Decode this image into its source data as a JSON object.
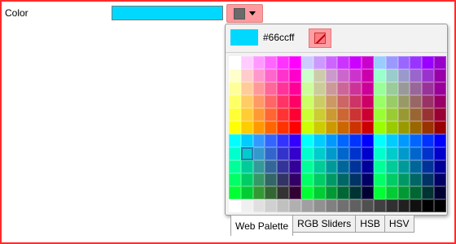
{
  "field": {
    "label": "Color",
    "value_color": "#00d8ff"
  },
  "dropdown": {
    "button_swatch": "#6a6a6a"
  },
  "popup": {
    "current_color_display": "#00d8ff",
    "hex_text": "#66ccff",
    "eyedropper_icon": "eyedropper-icon",
    "selected_cell": [
      7,
      1
    ],
    "palette_rows": [
      [
        "#ffffff",
        "#ffccff",
        "#ff99ff",
        "#ff66ff",
        "#ff33ff",
        "#ff00ff",
        "#ccccff",
        "#cc99ff",
        "#cc66ff",
        "#cc33ff",
        "#cc00ff",
        "#cc00cc",
        "#99ccff",
        "#9999ff",
        "#9966ff",
        "#9933ff",
        "#9900ff",
        "#9900cc"
      ],
      [
        "#ffffcc",
        "#ffcccc",
        "#ff99cc",
        "#ff66cc",
        "#ff33cc",
        "#ff00cc",
        "#ccffcc",
        "#ccccaa",
        "#cc99cc",
        "#cc66cc",
        "#cc33cc",
        "#cc00aa",
        "#99ffcc",
        "#99cccc",
        "#9999cc",
        "#9966cc",
        "#9933cc",
        "#9900aa"
      ],
      [
        "#ffff99",
        "#ffcc99",
        "#ff9999",
        "#ff6699",
        "#ff3399",
        "#ff0099",
        "#ccff99",
        "#cccc99",
        "#cc9999",
        "#cc6699",
        "#cc3399",
        "#cc0099",
        "#99ff99",
        "#99cc99",
        "#999999",
        "#996699",
        "#993399",
        "#990099"
      ],
      [
        "#ffff66",
        "#ffcc66",
        "#ff9966",
        "#ff6666",
        "#ff3366",
        "#ff0066",
        "#ccff66",
        "#cccc66",
        "#cc9966",
        "#cc6666",
        "#cc3366",
        "#cc0066",
        "#99ff66",
        "#99cc66",
        "#999966",
        "#996666",
        "#993366",
        "#990066"
      ],
      [
        "#ffff33",
        "#ffcc33",
        "#ff9933",
        "#ff6633",
        "#ff3333",
        "#ff0033",
        "#ccff33",
        "#cccc33",
        "#cc9933",
        "#cc6633",
        "#cc3333",
        "#cc0033",
        "#99ff33",
        "#99cc33",
        "#999933",
        "#996633",
        "#993333",
        "#990033"
      ],
      [
        "#ffff00",
        "#ffcc00",
        "#ff9900",
        "#ff6600",
        "#ff3300",
        "#ff0000",
        "#ccff00",
        "#cccc00",
        "#cc9900",
        "#cc6600",
        "#cc3300",
        "#cc0000",
        "#99ff00",
        "#99cc00",
        "#999900",
        "#996600",
        "#993300",
        "#990000"
      ],
      [
        "#00ffff",
        "#00ccff",
        "#3399ff",
        "#3366ff",
        "#3333ff",
        "#3300ff",
        "#00ffff",
        "#00ccff",
        "#0099ff",
        "#0066ff",
        "#0033ff",
        "#0000ff",
        "#00ffff",
        "#00ccff",
        "#0099ff",
        "#0066ff",
        "#0033ff",
        "#0000ff"
      ],
      [
        "#00ffcc",
        "#00cccc",
        "#3399cc",
        "#3366cc",
        "#3333cc",
        "#3300cc",
        "#00ffcc",
        "#00cccc",
        "#0099cc",
        "#0066cc",
        "#0033cc",
        "#0000cc",
        "#00ffcc",
        "#00cccc",
        "#0099cc",
        "#0066cc",
        "#0033cc",
        "#0000cc"
      ],
      [
        "#00ff99",
        "#00cc99",
        "#339999",
        "#336699",
        "#333399",
        "#330099",
        "#00ff99",
        "#00cc99",
        "#009999",
        "#006699",
        "#003399",
        "#000099",
        "#00ff99",
        "#00cc99",
        "#009999",
        "#006699",
        "#003399",
        "#000099"
      ],
      [
        "#00ff66",
        "#00cc66",
        "#339966",
        "#336666",
        "#333366",
        "#330066",
        "#00ff66",
        "#00cc66",
        "#009966",
        "#006666",
        "#003366",
        "#000066",
        "#00ff66",
        "#00cc66",
        "#009966",
        "#006666",
        "#003366",
        "#000066"
      ],
      [
        "#00ff33",
        "#00cc33",
        "#339933",
        "#336633",
        "#333333",
        "#330033",
        "#00ff33",
        "#00cc33",
        "#009933",
        "#006633",
        "#003333",
        "#000033",
        "#00ff33",
        "#00cc33",
        "#009933",
        "#006633",
        "#003333",
        "#000033"
      ],
      [
        "#ffffff",
        "#f0f0f0",
        "#e0e0e0",
        "#d0d0d0",
        "#c0c0c0",
        "#b0b0b0",
        "#a0a0a0",
        "#909090",
        "#808080",
        "#707070",
        "#606060",
        "#505050",
        "#404040",
        "#303030",
        "#202020",
        "#101010",
        "#000000",
        "#000000"
      ]
    ]
  },
  "tabs": [
    {
      "label": "Web Palette",
      "active": true
    },
    {
      "label": "RGB Sliders",
      "active": false
    },
    {
      "label": "HSB",
      "active": false
    },
    {
      "label": "HSV",
      "active": false
    }
  ]
}
